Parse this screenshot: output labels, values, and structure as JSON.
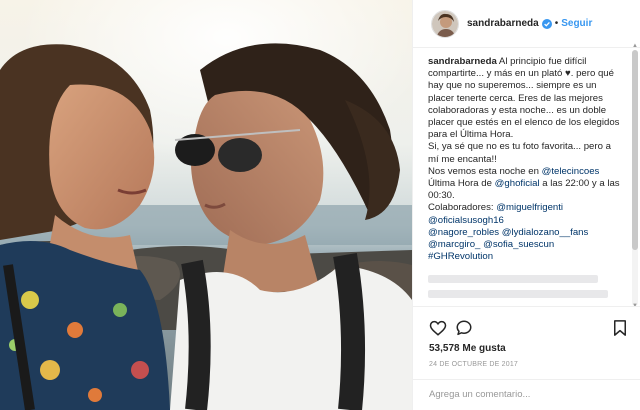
{
  "post": {
    "photo_alt": "Two women smiling at each other by the sea at sunset",
    "author": {
      "username": "sandrabarneda",
      "verified_icon": "verified-badge-icon",
      "separator": "•",
      "follow_label": "Seguir"
    },
    "caption": {
      "username": "sandrabarneda",
      "text_1": " Al principio fue difícil compartirte... y más en un plató ",
      "heart": "♥",
      "text_2": ". pero qué hay que no superemos... siempre es un placer tenerte cerca. Eres de las mejores colaboradoras y esta noche... es un doble placer que estés en el elenco de los elegidos para el Última Hora.",
      "line_2": "Si, ya sé que no es tu foto favorita... pero a mí me encanta!!",
      "line_3_pre": "Nos vemos esta noche en ",
      "line_3_link": "@telecincoes",
      "line_4_pre": "Última Hora de ",
      "line_4_link": "@ghoficial",
      "line_4_post": " a las 22:00 y a las 00:30.",
      "collab_label": "Colaboradores: ",
      "mentions": [
        "@miguelfrigenti",
        "@oficialsusogh16",
        "@nagore_robles",
        "@lydialozano__fans",
        "@marcgiro_",
        "@sofia_suescun"
      ],
      "hashtag": "#GHRevolution"
    },
    "actions": {
      "like_icon": "heart-outline-icon",
      "comment_icon": "speech-bubble-icon",
      "save_icon": "bookmark-outline-icon"
    },
    "likes_text": "53,578 Me gusta",
    "date_text": "24 DE OCTUBRE DE 2017",
    "comment_placeholder": "Agrega un comentario...",
    "colors": {
      "link": "#003569",
      "follow": "#3897f0",
      "text": "#262626",
      "muted": "#999999",
      "border": "#efefef"
    }
  }
}
